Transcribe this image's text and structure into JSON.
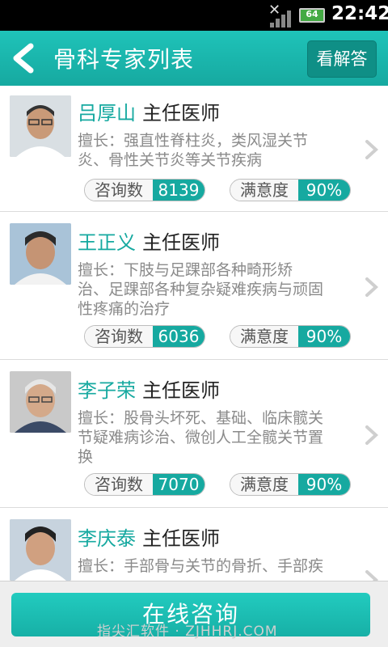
{
  "status_bar": {
    "battery": "64",
    "time": "22:42"
  },
  "header": {
    "title": "骨科专家列表",
    "right_button": "看解答"
  },
  "labels": {
    "consult": "咨询数",
    "satisfaction": "满意度"
  },
  "doctors": [
    {
      "name": "吕厚山",
      "title": "主任医师",
      "spec_lines": [
        "擅长：强直性脊柱炎，类风湿关节",
        "炎、骨性关节炎等关节疾病"
      ],
      "consult_count": "8139",
      "satisfaction": "90%"
    },
    {
      "name": "王正义",
      "title": "主任医师",
      "spec_lines": [
        "擅长：下肢与足踝部各种畸形矫",
        "治、足踝部各种复杂疑难疾病与顽固",
        "性疼痛的治疗"
      ],
      "consult_count": "6036",
      "satisfaction": "90%"
    },
    {
      "name": "李子荣",
      "title": "主任医师",
      "spec_lines": [
        "擅长：股骨头坏死、基础、临床髋关",
        "节疑难病诊治、微创人工全髋关节置",
        "换"
      ],
      "consult_count": "7070",
      "satisfaction": "90%"
    },
    {
      "name": "李庆泰",
      "title": "主任医师",
      "spec_lines": [
        "擅长：手部骨与关节的骨折、手部疾"
      ]
    }
  ],
  "footer": {
    "consult_button": "在线咨询",
    "watermark": "指尖汇软件 · ZJHHRJ.COM"
  }
}
